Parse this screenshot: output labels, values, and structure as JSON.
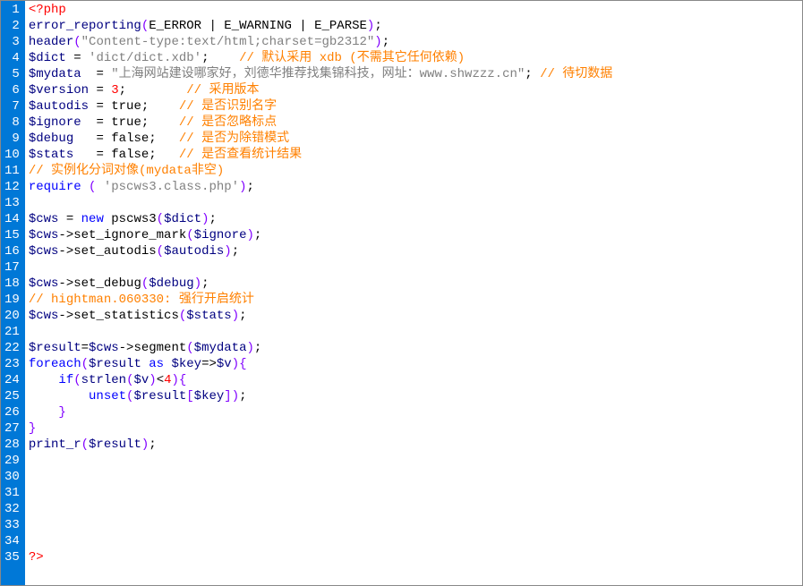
{
  "lines": [
    {
      "n": 1,
      "tokens": [
        [
          "tag",
          "<?php"
        ]
      ]
    },
    {
      "n": 2,
      "tokens": [
        [
          "func",
          "error_reporting"
        ],
        [
          "paren",
          "("
        ],
        [
          "plain",
          "E_ERROR "
        ],
        [
          "op",
          "|"
        ],
        [
          "plain",
          " E_WARNING "
        ],
        [
          "op",
          "|"
        ],
        [
          "plain",
          " E_PARSE"
        ],
        [
          "paren",
          ")"
        ],
        [
          "op",
          ";"
        ]
      ]
    },
    {
      "n": 3,
      "tokens": [
        [
          "func",
          "header"
        ],
        [
          "paren",
          "("
        ],
        [
          "string",
          "\"Content-type:text/html;charset=gb2312\""
        ],
        [
          "paren",
          ")"
        ],
        [
          "op",
          ";"
        ]
      ]
    },
    {
      "n": 4,
      "tokens": [
        [
          "variable",
          "$dict"
        ],
        [
          "plain",
          " "
        ],
        [
          "op",
          "="
        ],
        [
          "plain",
          " "
        ],
        [
          "string",
          "'dict/dict.xdb'"
        ],
        [
          "op",
          ";"
        ],
        [
          "plain",
          "    "
        ],
        [
          "comment",
          "// 默认采用 xdb (不需其它任何依赖)"
        ]
      ]
    },
    {
      "n": 5,
      "tokens": [
        [
          "variable",
          "$mydata"
        ],
        [
          "plain",
          "  "
        ],
        [
          "op",
          "="
        ],
        [
          "plain",
          " "
        ],
        [
          "string",
          "\"上海网站建设哪家好，刘德华推荐找集锦科技，网址：www.shwzzz.cn\""
        ],
        [
          "op",
          ";"
        ],
        [
          "plain",
          " "
        ],
        [
          "comment",
          "// 待切数据"
        ]
      ]
    },
    {
      "n": 6,
      "tokens": [
        [
          "variable",
          "$version"
        ],
        [
          "plain",
          " "
        ],
        [
          "op",
          "="
        ],
        [
          "plain",
          " "
        ],
        [
          "number",
          "3"
        ],
        [
          "op",
          ";"
        ],
        [
          "plain",
          "        "
        ],
        [
          "comment",
          "// 采用版本"
        ]
      ]
    },
    {
      "n": 7,
      "tokens": [
        [
          "variable",
          "$autodis"
        ],
        [
          "plain",
          " "
        ],
        [
          "op",
          "="
        ],
        [
          "plain",
          " "
        ],
        [
          "boolval",
          "true"
        ],
        [
          "op",
          ";"
        ],
        [
          "plain",
          "    "
        ],
        [
          "comment",
          "// 是否识别名字"
        ]
      ]
    },
    {
      "n": 8,
      "tokens": [
        [
          "variable",
          "$ignore"
        ],
        [
          "plain",
          "  "
        ],
        [
          "op",
          "="
        ],
        [
          "plain",
          " "
        ],
        [
          "boolval",
          "true"
        ],
        [
          "op",
          ";"
        ],
        [
          "plain",
          "    "
        ],
        [
          "comment",
          "// 是否忽略标点"
        ]
      ]
    },
    {
      "n": 9,
      "tokens": [
        [
          "variable",
          "$debug"
        ],
        [
          "plain",
          "   "
        ],
        [
          "op",
          "="
        ],
        [
          "plain",
          " "
        ],
        [
          "boolval",
          "false"
        ],
        [
          "op",
          ";"
        ],
        [
          "plain",
          "   "
        ],
        [
          "comment",
          "// 是否为除错模式"
        ]
      ]
    },
    {
      "n": 10,
      "tokens": [
        [
          "variable",
          "$stats"
        ],
        [
          "plain",
          "   "
        ],
        [
          "op",
          "="
        ],
        [
          "plain",
          " "
        ],
        [
          "boolval",
          "false"
        ],
        [
          "op",
          ";"
        ],
        [
          "plain",
          "   "
        ],
        [
          "comment",
          "// 是否查看统计结果"
        ]
      ]
    },
    {
      "n": 11,
      "tokens": [
        [
          "comment",
          "// 实例化分词对像(mydata非空)"
        ]
      ]
    },
    {
      "n": 12,
      "tokens": [
        [
          "keyword",
          "require"
        ],
        [
          "plain",
          " "
        ],
        [
          "paren",
          "("
        ],
        [
          "plain",
          " "
        ],
        [
          "string",
          "'pscws3.class.php'"
        ],
        [
          "paren",
          ")"
        ],
        [
          "op",
          ";"
        ]
      ]
    },
    {
      "n": 13,
      "tokens": []
    },
    {
      "n": 14,
      "tokens": [
        [
          "variable",
          "$cws"
        ],
        [
          "plain",
          " "
        ],
        [
          "op",
          "="
        ],
        [
          "plain",
          " "
        ],
        [
          "keyword",
          "new"
        ],
        [
          "plain",
          " pscws3"
        ],
        [
          "paren",
          "("
        ],
        [
          "variable",
          "$dict"
        ],
        [
          "paren",
          ")"
        ],
        [
          "op",
          ";"
        ]
      ]
    },
    {
      "n": 15,
      "tokens": [
        [
          "variable",
          "$cws"
        ],
        [
          "op",
          "->"
        ],
        [
          "plain",
          "set_ignore_mark"
        ],
        [
          "paren",
          "("
        ],
        [
          "variable",
          "$ignore"
        ],
        [
          "paren",
          ")"
        ],
        [
          "op",
          ";"
        ]
      ]
    },
    {
      "n": 16,
      "tokens": [
        [
          "variable",
          "$cws"
        ],
        [
          "op",
          "->"
        ],
        [
          "plain",
          "set_autodis"
        ],
        [
          "paren",
          "("
        ],
        [
          "variable",
          "$autodis"
        ],
        [
          "paren",
          ")"
        ],
        [
          "op",
          ";"
        ]
      ]
    },
    {
      "n": 17,
      "tokens": []
    },
    {
      "n": 18,
      "tokens": [
        [
          "variable",
          "$cws"
        ],
        [
          "op",
          "->"
        ],
        [
          "plain",
          "set_debug"
        ],
        [
          "paren",
          "("
        ],
        [
          "variable",
          "$debug"
        ],
        [
          "paren",
          ")"
        ],
        [
          "op",
          ";"
        ]
      ]
    },
    {
      "n": 19,
      "tokens": [
        [
          "comment",
          "// hightman.060330: 强行开启统计"
        ]
      ]
    },
    {
      "n": 20,
      "tokens": [
        [
          "variable",
          "$cws"
        ],
        [
          "op",
          "->"
        ],
        [
          "plain",
          "set_statistics"
        ],
        [
          "paren",
          "("
        ],
        [
          "variable",
          "$stats"
        ],
        [
          "paren",
          ")"
        ],
        [
          "op",
          ";"
        ]
      ]
    },
    {
      "n": 21,
      "tokens": []
    },
    {
      "n": 22,
      "tokens": [
        [
          "variable",
          "$result"
        ],
        [
          "op",
          "="
        ],
        [
          "variable",
          "$cws"
        ],
        [
          "op",
          "->"
        ],
        [
          "plain",
          "segment"
        ],
        [
          "paren",
          "("
        ],
        [
          "variable",
          "$mydata"
        ],
        [
          "paren",
          ")"
        ],
        [
          "op",
          ";"
        ]
      ]
    },
    {
      "n": 23,
      "tokens": [
        [
          "keyword",
          "foreach"
        ],
        [
          "paren",
          "("
        ],
        [
          "variable",
          "$result"
        ],
        [
          "plain",
          " "
        ],
        [
          "keyword",
          "as"
        ],
        [
          "plain",
          " "
        ],
        [
          "variable",
          "$key"
        ],
        [
          "op",
          "=>"
        ],
        [
          "variable",
          "$v"
        ],
        [
          "paren",
          ")"
        ],
        [
          "paren",
          "{"
        ]
      ]
    },
    {
      "n": 24,
      "tokens": [
        [
          "plain",
          "    "
        ],
        [
          "keyword",
          "if"
        ],
        [
          "paren",
          "("
        ],
        [
          "func",
          "strlen"
        ],
        [
          "paren",
          "("
        ],
        [
          "variable",
          "$v"
        ],
        [
          "paren",
          ")"
        ],
        [
          "op",
          "<"
        ],
        [
          "number",
          "4"
        ],
        [
          "paren",
          ")"
        ],
        [
          "paren",
          "{"
        ]
      ]
    },
    {
      "n": 25,
      "tokens": [
        [
          "plain",
          "        "
        ],
        [
          "keyword",
          "unset"
        ],
        [
          "paren",
          "("
        ],
        [
          "variable",
          "$result"
        ],
        [
          "bracket",
          "["
        ],
        [
          "variable",
          "$key"
        ],
        [
          "bracket",
          "]"
        ],
        [
          "paren",
          ")"
        ],
        [
          "op",
          ";"
        ]
      ]
    },
    {
      "n": 26,
      "tokens": [
        [
          "plain",
          "    "
        ],
        [
          "paren",
          "}"
        ]
      ]
    },
    {
      "n": 27,
      "tokens": [
        [
          "paren",
          "}"
        ]
      ]
    },
    {
      "n": 28,
      "tokens": [
        [
          "func",
          "print_r"
        ],
        [
          "paren",
          "("
        ],
        [
          "variable",
          "$result"
        ],
        [
          "paren",
          ")"
        ],
        [
          "op",
          ";"
        ]
      ]
    },
    {
      "n": 29,
      "tokens": []
    },
    {
      "n": 30,
      "tokens": []
    },
    {
      "n": 31,
      "tokens": []
    },
    {
      "n": 32,
      "tokens": []
    },
    {
      "n": 33,
      "tokens": []
    },
    {
      "n": 34,
      "tokens": []
    },
    {
      "n": 35,
      "tokens": [
        [
          "tag",
          "?>"
        ]
      ]
    }
  ]
}
